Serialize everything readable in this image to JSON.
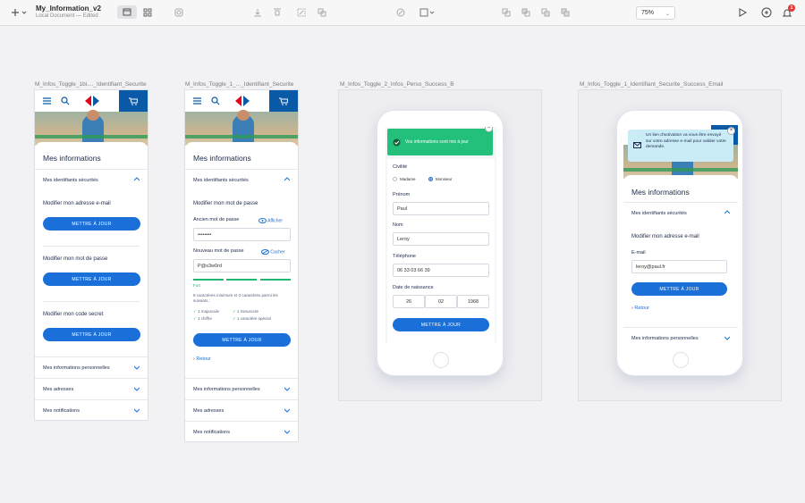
{
  "toolbar": {
    "doc_title": "My_Information_v2",
    "doc_subtitle": "Local Document — Edited",
    "zoom": "75%",
    "notifications_count": "1"
  },
  "artboards": [
    {
      "label": "M_Infos_Toggle_1bi...._Identifiant_Securite"
    },
    {
      "label": "M_Infos_Toggle_1_..._Identifiant_Securite"
    },
    {
      "label": "M_Infos_Toggle_2_Infos_Perso_Success_B"
    },
    {
      "label": "M_Infos_Toggle_1_Identifiant_Securite_Success_Email"
    }
  ],
  "common": {
    "page_title": "Mes informations",
    "section_ids": "Mes identifiants sécurités",
    "section_perso": "Mes informations personnelles",
    "section_addresses": "Mes adresses",
    "section_notifications": "Mes notifications",
    "update_btn": "METTRE À JOUR",
    "back_link": "Retour"
  },
  "ab1": {
    "modify_email": "Modifier mon adresse e-mail",
    "modify_password": "Modifier mon mot de passe",
    "modify_code": "Modifier mon code secret"
  },
  "ab2": {
    "modify_password": "Modifier mon mot de passe",
    "old_pw_label": "Ancien mot de passe",
    "show": "Afficher",
    "old_pw_value": "••••••••",
    "new_pw_label": "Nouveau mot de passe",
    "hide": "Cacher",
    "new_pw_value": "P@s3w0rd",
    "strength": "Fort",
    "rules_intro": "8 caractères minimum et 3 caractères parmi les suivants :",
    "rule1": "1 majuscule",
    "rule2": "1 minuscule",
    "rule3": "1 chiffre",
    "rule4": "1 caractère spécial"
  },
  "ab3": {
    "toast": "Vos informations sont mis à jour",
    "civilite_label": "Civilité",
    "madame": "Madame",
    "monsieur": "Monsieur",
    "prenom_label": "Prénom",
    "prenom_value": "Paul",
    "nom_label": "Nom",
    "nom_value": "Leroy",
    "tel_label": "Téléphone",
    "tel_value": "06 33 03 66 39",
    "dob_label": "Date de naissance",
    "dob_day": "26",
    "dob_month": "02",
    "dob_year": "1968"
  },
  "ab4": {
    "toast": "Un lien d'activation va vous être envoyé sur votre adresse e-mail pour valider votre demande.",
    "modify_email": "Modifier mon adresse e-mail",
    "email_label": "E-mail",
    "email_value": "leroy@paul.fr"
  },
  "colors": {
    "brand_blue": "#0a5aa8",
    "button_blue": "#1a6fd8",
    "success_green": "#22c07a",
    "info_blue": "#c9ecf7"
  }
}
